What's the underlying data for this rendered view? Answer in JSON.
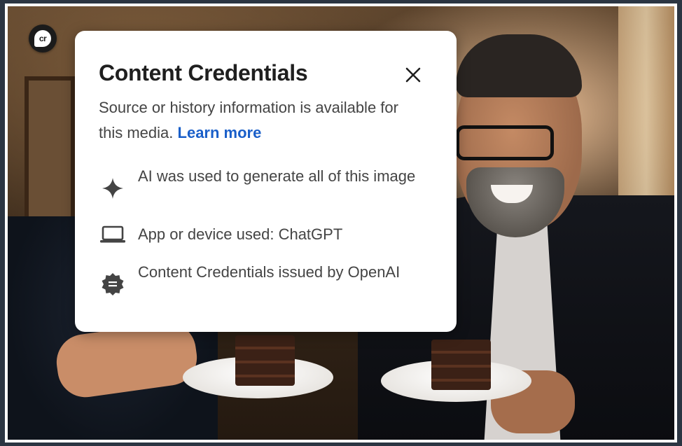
{
  "badge": {
    "text": "cr"
  },
  "card": {
    "title": "Content Credentials",
    "description": "Source or history information is available for this media.",
    "learn_more": "Learn more",
    "items": [
      {
        "icon": "sparkle-icon",
        "text": "AI was used to generate all of this image"
      },
      {
        "icon": "laptop-icon",
        "text": "App or device used: ChatGPT"
      },
      {
        "icon": "certificate-badge-icon",
        "text": "Content Credentials issued by OpenAI"
      }
    ]
  },
  "colors": {
    "link": "#1a5fc9",
    "title_text": "#1f1f1f",
    "body_text": "#444444",
    "badge_bg": "#1b1b1b",
    "page_bg": "#2b3542"
  }
}
